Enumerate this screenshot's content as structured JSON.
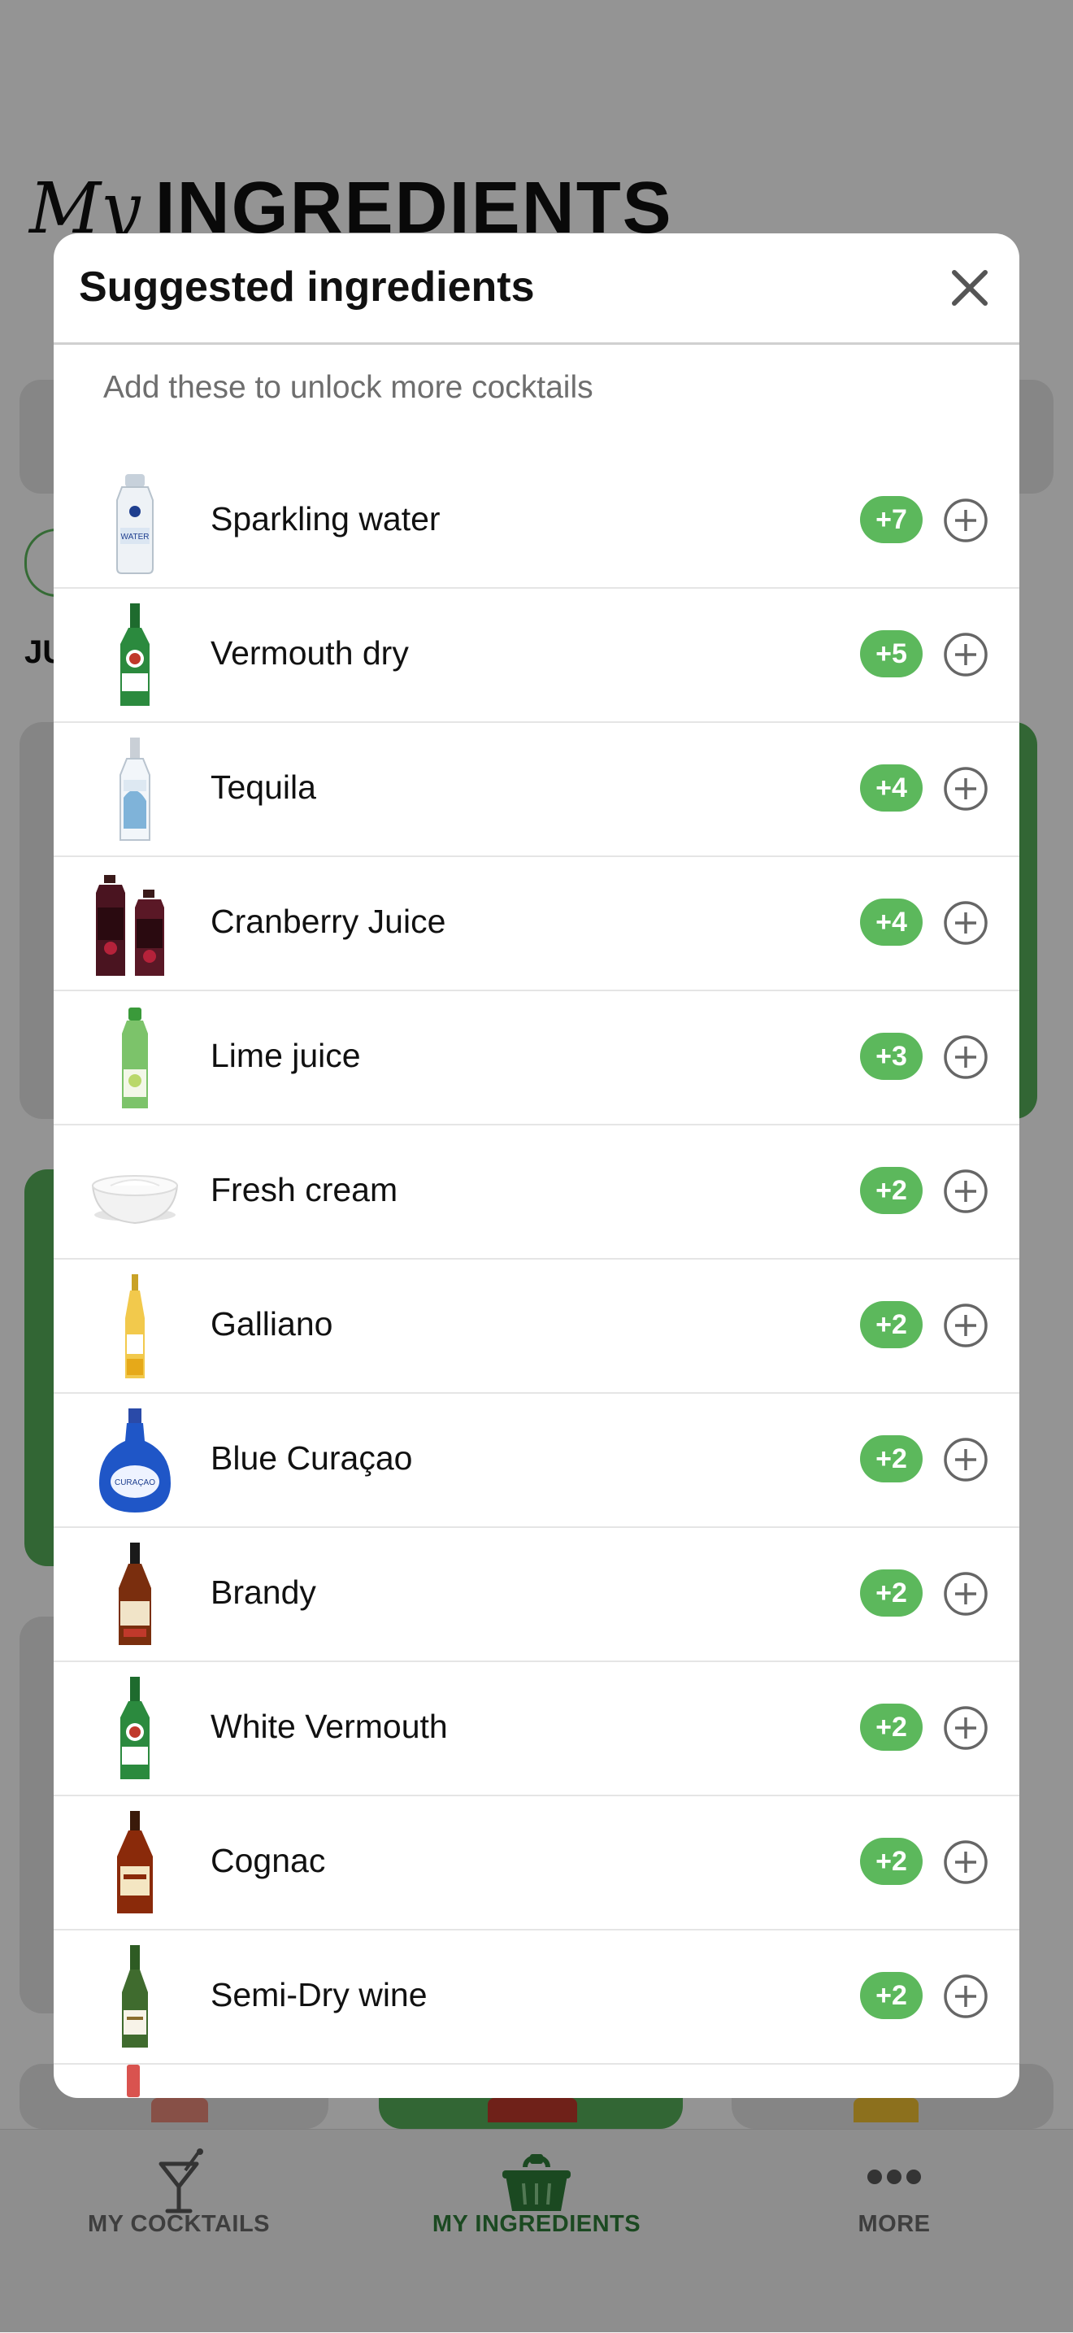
{
  "page": {
    "title_script": "My",
    "title_bold": "INGREDIENTS",
    "section_label": "JU"
  },
  "modal": {
    "title": "Suggested ingredients",
    "subtitle": "Add these to unlock more cocktails",
    "items": [
      {
        "name": "Sparkling water",
        "badge": "+7",
        "icon": "sparkling-water-bottle"
      },
      {
        "name": "Vermouth dry",
        "badge": "+5",
        "icon": "vermouth-bottle"
      },
      {
        "name": "Tequila",
        "badge": "+4",
        "icon": "tequila-bottle"
      },
      {
        "name": "Cranberry Juice",
        "badge": "+4",
        "icon": "cranberry-juice-bottles"
      },
      {
        "name": "Lime juice",
        "badge": "+3",
        "icon": "lime-juice-bottle"
      },
      {
        "name": "Fresh cream",
        "badge": "+2",
        "icon": "cream-bowl"
      },
      {
        "name": "Galliano",
        "badge": "+2",
        "icon": "galliano-bottle"
      },
      {
        "name": "Blue Curaçao",
        "badge": "+2",
        "icon": "blue-curacao-bottle"
      },
      {
        "name": "Brandy",
        "badge": "+2",
        "icon": "brandy-bottle"
      },
      {
        "name": "White Vermouth",
        "badge": "+2",
        "icon": "vermouth-bottle"
      },
      {
        "name": "Cognac",
        "badge": "+2",
        "icon": "cognac-bottle"
      },
      {
        "name": "Semi-Dry wine",
        "badge": "+2",
        "icon": "wine-bottle"
      }
    ]
  },
  "tabs": [
    {
      "label": "MY COCKTAILS",
      "icon": "cocktail-glass-icon",
      "active": false
    },
    {
      "label": "MY INGREDIENTS",
      "icon": "basket-icon",
      "active": true
    },
    {
      "label": "MORE",
      "icon": "more-dots-icon",
      "active": false
    }
  ],
  "colors": {
    "accent_green": "#5cb85c",
    "active_tab_green": "#2f7f3a",
    "overlay": "rgba(0,0,0,0.42)"
  }
}
